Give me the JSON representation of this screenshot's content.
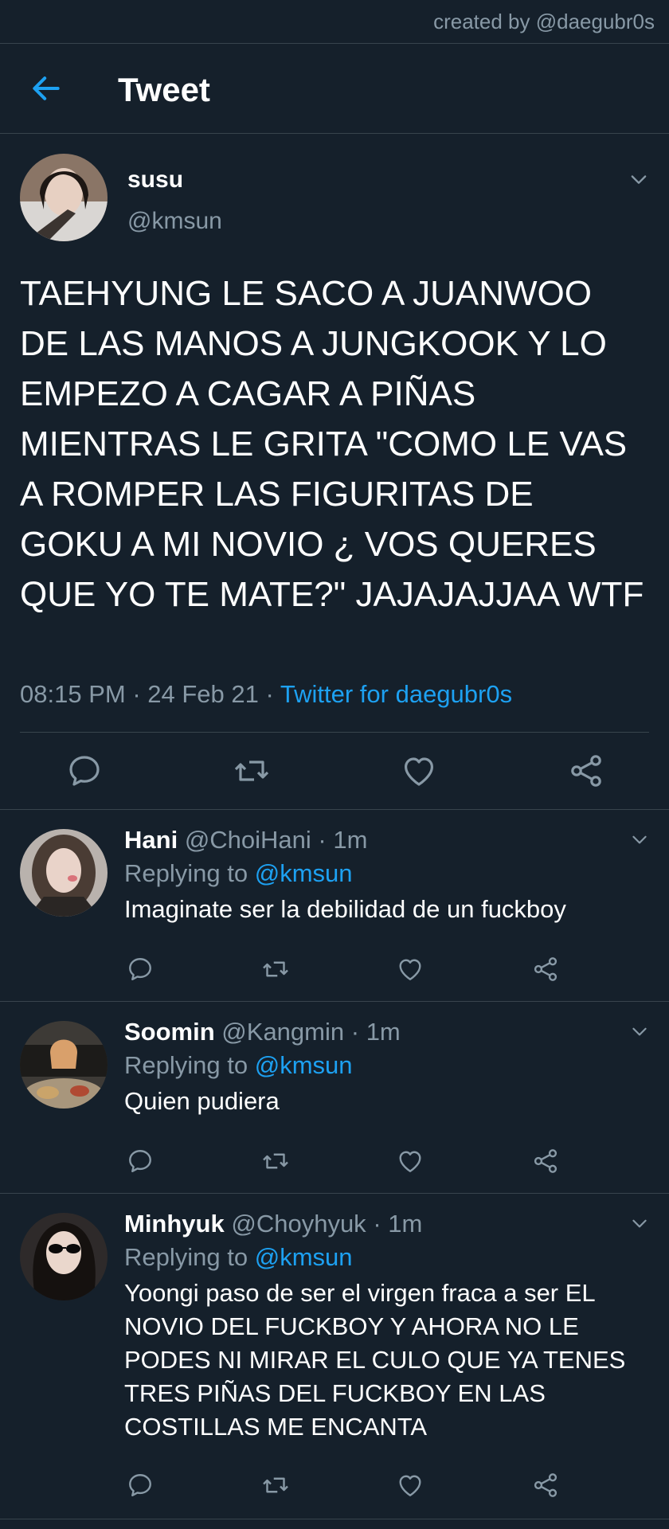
{
  "watermark": "created by @daegubr0s",
  "header": {
    "title": "Tweet"
  },
  "tweet": {
    "name": "susu",
    "handle": "@kmsun",
    "text": "TAEHYUNG LE SACO A JUANWOO DE LAS MANOS A JUNGKOOK Y LO EMPEZO A CAGAR A PIÑAS MIENTRAS LE GRITA \"COMO LE VAS A ROMPER LAS FIGURITAS DE GOKU A MI NOVIO ¿ VOS QUERES QUE YO TE MATE?\" JAJAJAJJAA WTF",
    "time": "08:15 PM",
    "date": "24 Feb 21",
    "source": "Twitter for daegubr0s"
  },
  "replies": [
    {
      "name": "Hani",
      "handle": "@ChoiHani",
      "time": "1m",
      "replying_label": "Replying to",
      "replying_to": "@kmsun",
      "text": "Imaginate ser la debilidad de un fuckboy"
    },
    {
      "name": "Soomin",
      "handle": "@Kangmin",
      "time": "1m",
      "replying_label": "Replying to",
      "replying_to": "@kmsun",
      "text": "Quien pudiera"
    },
    {
      "name": "Minhyuk",
      "handle": "@Choyhyuk",
      "time": "1m",
      "replying_label": "Replying to",
      "replying_to": "@kmsun",
      "text": "Yoongi paso de ser el virgen fraca a ser EL NOVIO DEL FUCKBOY Y AHORA NO LE PODES NI MIRAR EL CULO QUE YA TENES TRES PIÑAS DEL FUCKBOY EN LAS COSTILLAS ME ENCANTA"
    }
  ],
  "icons": {
    "back": "arrow-left-icon",
    "menu": "chevron-down-icon",
    "reply": "comment-icon",
    "retweet": "retweet-icon",
    "like": "heart-icon",
    "share": "share-icon"
  },
  "colors": {
    "background": "#15202b",
    "accent": "#1da1f2",
    "secondary_text": "#8899a6",
    "divider": "#38444d"
  }
}
